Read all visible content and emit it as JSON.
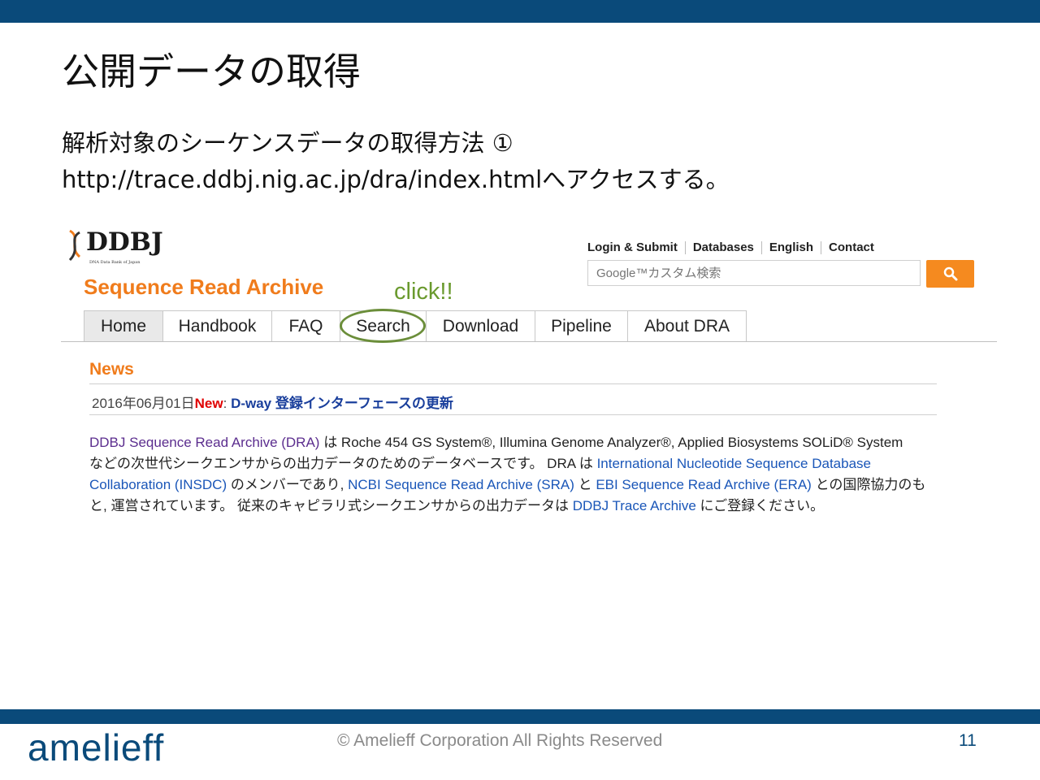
{
  "slide": {
    "title": "公開データの取得",
    "line1": "解析対象のシーケンスデータの取得方法 ①",
    "line2": "http://trace.ddbj.nig.ac.jp/dra/index.htmlへアクセスする。"
  },
  "site": {
    "logo_text": "DDBJ",
    "logo_subtext": "DNA Data Bank of Japan",
    "title": "Sequence Read Archive",
    "util_nav": [
      "Login & Submit",
      "Databases",
      "English",
      "Contact"
    ],
    "search": {
      "placeholder": "Google™カスタム検索"
    },
    "tabs": [
      {
        "label": "Home",
        "active": true
      },
      {
        "label": "Handbook",
        "active": false
      },
      {
        "label": "FAQ",
        "active": false
      },
      {
        "label": "Search",
        "active": false
      },
      {
        "label": "Download",
        "active": false
      },
      {
        "label": "Pipeline",
        "active": false
      },
      {
        "label": "About DRA",
        "active": false
      }
    ],
    "news": {
      "heading": "News",
      "date": "2016年06月01日",
      "new_tag": "New",
      "colon": ": ",
      "link": "D-way 登録インターフェースの更新"
    },
    "description": {
      "l1a": "DDBJ Sequence Read Archive (DRA)",
      "l1b": " は Roche 454 GS System®,  Illumina Genome Analyzer®,  Applied Biosystems SOLiD® System",
      "l2a": "などの次世代シークエンサからの出力データのためのデータベースです。 DRA は ",
      "l2b": "International Nucleotide Sequence Database",
      "l3a": "Collaboration (INSDC)",
      "l3b": " のメンバーであり,  ",
      "l3c": "NCBI Sequence Read Archive (SRA)",
      "l3d": " と ",
      "l3e": "EBI Sequence Read Archive (ERA)",
      "l3f": " との国際協力のも",
      "l4a": "と,  運営されています。 従来のキャピラリ式シークエンサからの出力データは ",
      "l4b": "DDBJ Trace Archive",
      "l4c": " にご登録ください。"
    }
  },
  "annotation": {
    "text": "click!!",
    "color": "#6a9a2e"
  },
  "footer": {
    "brand": "amelieff",
    "copyright": "© Amelieff Corporation All Rights Reserved",
    "page": "11"
  },
  "colors": {
    "accent": "#0a4a7a",
    "orange": "#f07c1c",
    "new": "#e00000"
  },
  "icons": [
    "search-icon",
    "dna-helix-icon"
  ]
}
